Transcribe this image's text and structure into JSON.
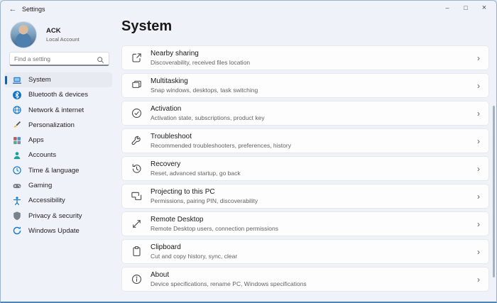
{
  "window": {
    "title": "Settings",
    "controls": {
      "minimize": "–",
      "maximize": "□",
      "close": "×"
    }
  },
  "icons": {
    "back": "←",
    "chevron": "›"
  },
  "sidebar": {
    "account": {
      "name": "ACK",
      "type": "Local Account"
    },
    "search": {
      "placeholder": "Find a setting"
    },
    "items": [
      {
        "label": "System",
        "icon": "system-icon",
        "selected": true
      },
      {
        "label": "Bluetooth & devices",
        "icon": "bluetooth-icon",
        "selected": false
      },
      {
        "label": "Network & internet",
        "icon": "network-icon",
        "selected": false
      },
      {
        "label": "Personalization",
        "icon": "personalization-icon",
        "selected": false
      },
      {
        "label": "Apps",
        "icon": "apps-icon",
        "selected": false
      },
      {
        "label": "Accounts",
        "icon": "accounts-icon",
        "selected": false
      },
      {
        "label": "Time & language",
        "icon": "time-language-icon",
        "selected": false
      },
      {
        "label": "Gaming",
        "icon": "gaming-icon",
        "selected": false
      },
      {
        "label": "Accessibility",
        "icon": "accessibility-icon",
        "selected": false
      },
      {
        "label": "Privacy & security",
        "icon": "privacy-security-icon",
        "selected": false
      },
      {
        "label": "Windows Update",
        "icon": "windows-update-icon",
        "selected": false
      }
    ]
  },
  "main": {
    "heading": "System",
    "cards": [
      {
        "title": "Nearby sharing",
        "subtitle": "Discoverability, received files location",
        "icon": "nearby-sharing-icon"
      },
      {
        "title": "Multitasking",
        "subtitle": "Snap windows, desktops, task switching",
        "icon": "multitasking-icon"
      },
      {
        "title": "Activation",
        "subtitle": "Activation state, subscriptions, product key",
        "icon": "activation-icon"
      },
      {
        "title": "Troubleshoot",
        "subtitle": "Recommended troubleshooters, preferences, history",
        "icon": "troubleshoot-icon"
      },
      {
        "title": "Recovery",
        "subtitle": "Reset, advanced startup, go back",
        "icon": "recovery-icon"
      },
      {
        "title": "Projecting to this PC",
        "subtitle": "Permissions, pairing PIN, discoverability",
        "icon": "projecting-icon"
      },
      {
        "title": "Remote Desktop",
        "subtitle": "Remote Desktop users, connection permissions",
        "icon": "remote-desktop-icon"
      },
      {
        "title": "Clipboard",
        "subtitle": "Cut and copy history, sync, clear",
        "icon": "clipboard-icon"
      },
      {
        "title": "About",
        "subtitle": "Device specifications, rename PC, Windows specifications",
        "icon": "about-icon"
      }
    ]
  },
  "colors": {
    "accent": "#0067c0",
    "window_background": "#eff3f9",
    "card_background": "#fdfdfe",
    "selected_nav_background": "#e7ebf1"
  }
}
